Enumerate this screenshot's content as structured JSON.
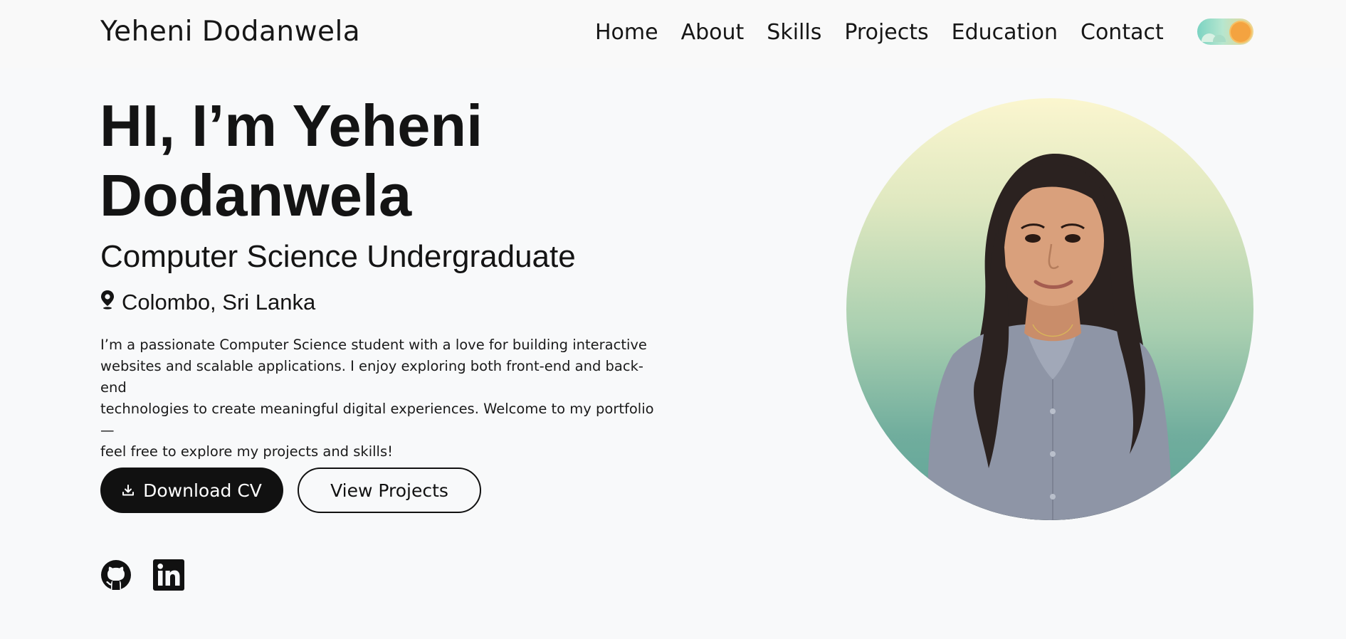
{
  "nav": {
    "brand": "Yeheni Dodanwela",
    "links": [
      "Home",
      "About",
      "Skills",
      "Projects",
      "Education",
      "Contact"
    ]
  },
  "hero": {
    "title_line1": "HI, I’m Yeheni",
    "title_line2": "Dodanwela",
    "subtitle": "Computer Science Undergraduate",
    "location": "Colombo, Sri Lanka",
    "bio_lines": [
      "I’m a passionate Computer Science student with a love for building interactive",
      "websites and scalable applications. I enjoy exploring both front-end and back-end",
      "technologies to create meaningful digital experiences. Welcome to my portfolio—",
      "feel free to explore my projects and skills!"
    ],
    "download_cv_label": "Download CV",
    "view_projects_label": "View Projects"
  },
  "icons": {
    "location": "map-pin-icon",
    "download": "download-icon",
    "github": "github-icon",
    "linkedin": "linkedin-icon",
    "theme_toggle": "sun-icon"
  },
  "colors": {
    "background": "#f8f9fa",
    "text": "#141414",
    "button_dark": "#111111",
    "portrait_gradient_top": "#fbf6cf",
    "portrait_gradient_bottom": "#5ea498",
    "toggle_sun": "#f4a340"
  }
}
